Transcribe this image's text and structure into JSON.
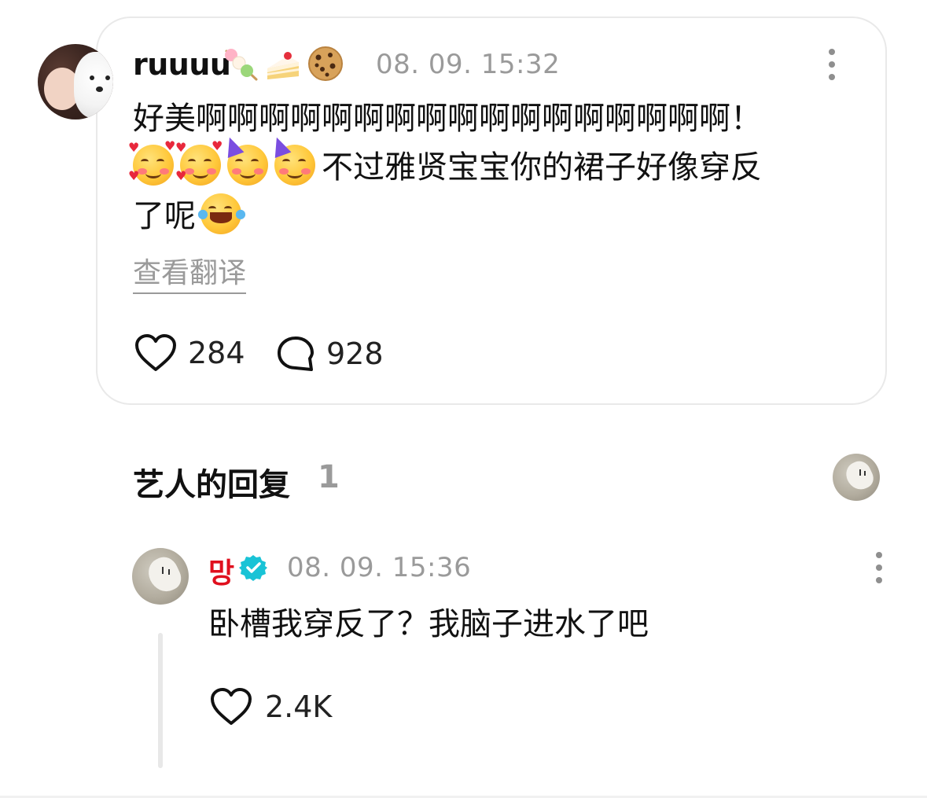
{
  "comment": {
    "username": "ruuuu",
    "username_emojis": [
      "dango-icon",
      "cake-icon",
      "cookie-icon"
    ],
    "timestamp": "08. 09. 15:32",
    "text_line1": "好美啊啊啊啊啊啊啊啊啊啊啊啊啊啊啊啊啊！",
    "text_line2": "不过雅贤宝宝你的裙子好像穿反",
    "text_line3": "了呢",
    "translate_label": "查看翻译",
    "likes": "284",
    "replies": "928"
  },
  "artist_reply_section": {
    "title": "艺人的回复",
    "count": "1"
  },
  "reply": {
    "username": "망",
    "timestamp": "08. 09. 15:36",
    "text": "卧槽我穿反了？我脑子进水了吧",
    "likes": "2.4K"
  },
  "colors": {
    "artist_name": "#e0101e",
    "verified_badge": "#19c3d6",
    "muted_text": "#9a9a9a",
    "card_border": "#e9e9e9"
  }
}
